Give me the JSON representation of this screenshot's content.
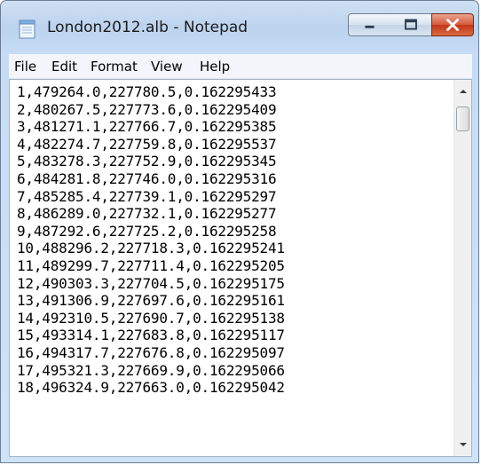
{
  "window": {
    "title": "London2012.alb - Notepad",
    "buttons": {
      "minimize": "minimize",
      "maximize": "maximize",
      "close": "close"
    }
  },
  "menu": [
    "File",
    "Edit",
    "Format",
    "View",
    "Help"
  ],
  "document": {
    "lines": [
      "1,479264.0,227780.5,0.162295433",
      "2,480267.5,227773.6,0.162295409",
      "3,481271.1,227766.7,0.162295385",
      "4,482274.7,227759.8,0.162295537",
      "5,483278.3,227752.9,0.162295345",
      "6,484281.8,227746.0,0.162295316",
      "7,485285.4,227739.1,0.162295297",
      "8,486289.0,227732.1,0.162295277",
      "9,487292.6,227725.2,0.162295258",
      "10,488296.2,227718.3,0.162295241",
      "11,489299.7,227711.4,0.162295205",
      "12,490303.3,227704.5,0.162295175",
      "13,491306.9,227697.6,0.162295161",
      "14,492310.5,227690.7,0.162295138",
      "15,493314.1,227683.8,0.162295117",
      "16,494317.7,227676.8,0.162295097",
      "17,495321.3,227669.9,0.162295066",
      "18,496324.9,227663.0,0.162295042"
    ]
  },
  "icons": {
    "app": "notepad-icon",
    "minimize": "minimize-icon",
    "maximize": "maximize-icon",
    "close": "close-icon",
    "scroll_up": "arrow-up-icon",
    "scroll_down": "arrow-down-icon"
  },
  "colors": {
    "close_button": "#c3361a",
    "titlebar": "#bcd3ee"
  }
}
